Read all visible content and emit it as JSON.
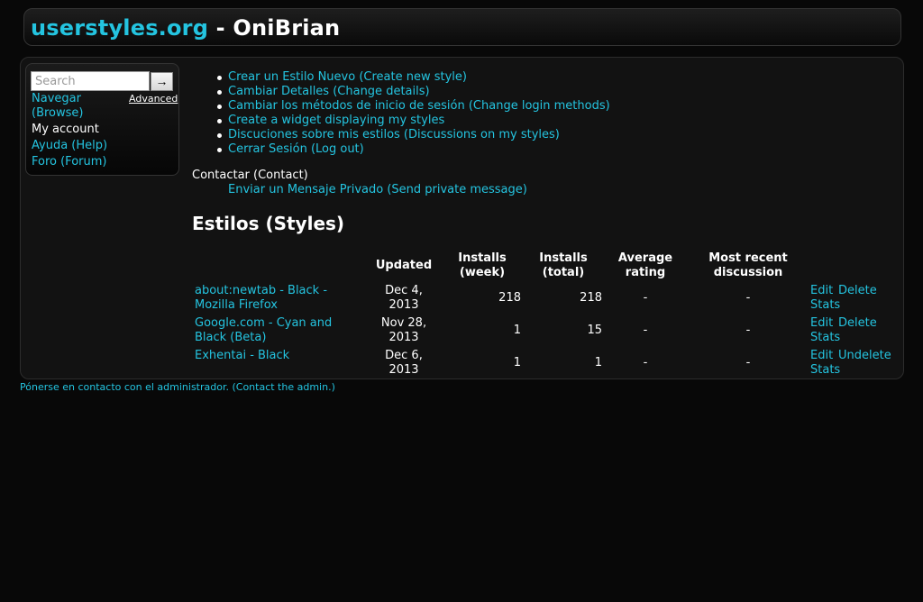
{
  "header": {
    "site_name": "userstyles.org",
    "separator": " - ",
    "username": "OniBrian"
  },
  "sidebar": {
    "search": {
      "placeholder": "Search",
      "button_glyph": "→",
      "advanced_label": "Advanced"
    },
    "nav": [
      {
        "label": "Navegar (Browse)",
        "link": true
      },
      {
        "label": "My account",
        "link": false
      },
      {
        "label": "Ayuda (Help)",
        "link": true
      },
      {
        "label": "Foro (Forum)",
        "link": true
      }
    ]
  },
  "actions": [
    "Crear un Estilo Nuevo (Create new style)",
    "Cambiar Detalles (Change details)",
    "Cambiar los métodos de inicio de sesión (Change login methods)",
    "Create a widget displaying my styles",
    "Discuciones sobre mis estilos (Discussions on my styles)",
    "Cerrar Sesión (Log out)"
  ],
  "contact": {
    "label": "Contactar (Contact)",
    "link": "Enviar un Mensaje Privado (Send private message)"
  },
  "styles": {
    "heading": "Estilos (Styles)",
    "columns": {
      "updated": "Updated",
      "installs_week": "Installs (week)",
      "installs_total": "Installs (total)",
      "average_rating": "Average rating",
      "most_recent_discussion": "Most recent discussion"
    },
    "rows": [
      {
        "name": "about:newtab - Black - Mozilla Firefox",
        "updated": "Dec 4, 2013",
        "installs_week": "218",
        "installs_total": "218",
        "rating": "-",
        "discussion": "-",
        "edit": "Edit",
        "toggle": "Delete",
        "stats": "Stats"
      },
      {
        "name": "Google.com - Cyan and Black (Beta)",
        "updated": "Nov 28, 2013",
        "installs_week": "1",
        "installs_total": "15",
        "rating": "-",
        "discussion": "-",
        "edit": "Edit",
        "toggle": "Delete",
        "stats": "Stats"
      },
      {
        "name": "Exhentai - Black",
        "updated": "Dec 6, 2013",
        "installs_week": "1",
        "installs_total": "1",
        "rating": "-",
        "discussion": "-",
        "edit": "Edit",
        "toggle": "Undelete",
        "stats": "Stats"
      }
    ]
  },
  "footer": {
    "contact_admin": "Pónerse en contacto con el administrador. (Contact the admin.)"
  },
  "colors": {
    "link": "#24c4e0",
    "background": "#080808",
    "panel": "#121212",
    "text": "#ffffff"
  }
}
